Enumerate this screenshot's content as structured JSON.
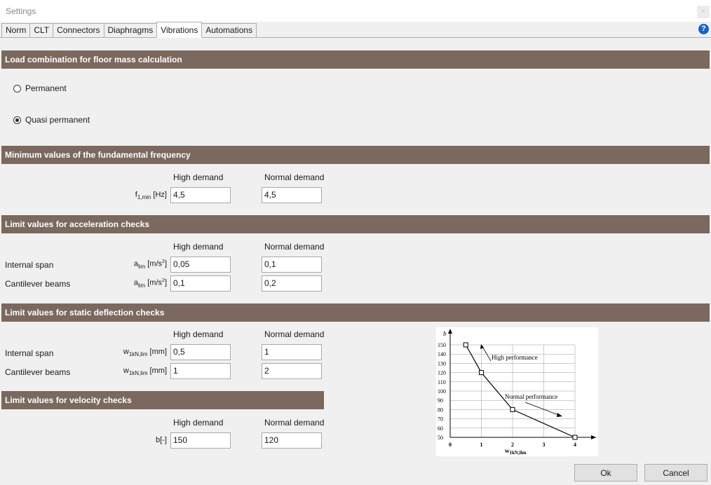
{
  "window": {
    "title": "Settings",
    "close_label": "×"
  },
  "tabs": [
    {
      "label": "Norm"
    },
    {
      "label": "CLT"
    },
    {
      "label": "Connectors"
    },
    {
      "label": "Diaphragms"
    },
    {
      "label": "Vibrations",
      "active": true
    },
    {
      "label": "Automations"
    }
  ],
  "help_label": "?",
  "sections": {
    "load_combination": "Load combination for floor mass calculation",
    "fundamental_frequency": "Minimum values of the fundamental frequency",
    "acceleration": "Limit values for acceleration checks",
    "static_deflection": "Limit values for static deflection checks",
    "velocity": "Limit values for velocity checks"
  },
  "load_combination": {
    "options": [
      {
        "label": "Permanent",
        "selected": false
      },
      {
        "label": "Quasi permanent",
        "selected": true
      }
    ]
  },
  "columns": {
    "high": "High demand",
    "normal": "Normal demand"
  },
  "frequency": {
    "unit_main": "f",
    "unit_sub": "1,min",
    "unit_tail": " [Hz]",
    "high": "4,5",
    "normal": "4,5"
  },
  "acceleration": {
    "rows": [
      {
        "label": "Internal span",
        "unit_main": "a",
        "unit_sub": "lim",
        "unit_tail": " [m/s",
        "unit_sup": "2",
        "unit_end": "]",
        "high": "0,05",
        "normal": "0,1"
      },
      {
        "label": "Cantilever beams",
        "unit_main": "a",
        "unit_sub": "lim",
        "unit_tail": " [m/s",
        "unit_sup": "2",
        "unit_end": "]",
        "high": "0,1",
        "normal": "0,2"
      }
    ]
  },
  "deflection": {
    "rows": [
      {
        "label": "Internal span",
        "unit_main": "w",
        "unit_sub": "1kN,lim",
        "unit_tail": " [mm]",
        "high": "0,5",
        "normal": "1"
      },
      {
        "label": "Cantilever beams",
        "unit_main": "w",
        "unit_sub": "1kN,lim",
        "unit_tail": " [mm]",
        "high": "1",
        "normal": "2"
      }
    ]
  },
  "velocity": {
    "unit": "b[-]",
    "high": "150",
    "normal": "120"
  },
  "graph": {
    "y_label": "b",
    "x_label_main": "w",
    "x_label_sub": "1kN,lim",
    "y_ticks": [
      "150",
      "140",
      "130",
      "120",
      "110",
      "100",
      "90",
      "80",
      "70",
      "60",
      "50"
    ],
    "x_ticks": [
      "0",
      "1",
      "2",
      "3",
      "4"
    ],
    "annotation_high": "High performance",
    "annotation_normal": "Normal performance",
    "points": [
      {
        "x": 0.5,
        "y": 150
      },
      {
        "x": 1,
        "y": 120
      },
      {
        "x": 2,
        "y": 80
      },
      {
        "x": 4,
        "y": 50
      }
    ]
  },
  "buttons": {
    "ok": "Ok",
    "cancel": "Cancel"
  }
}
